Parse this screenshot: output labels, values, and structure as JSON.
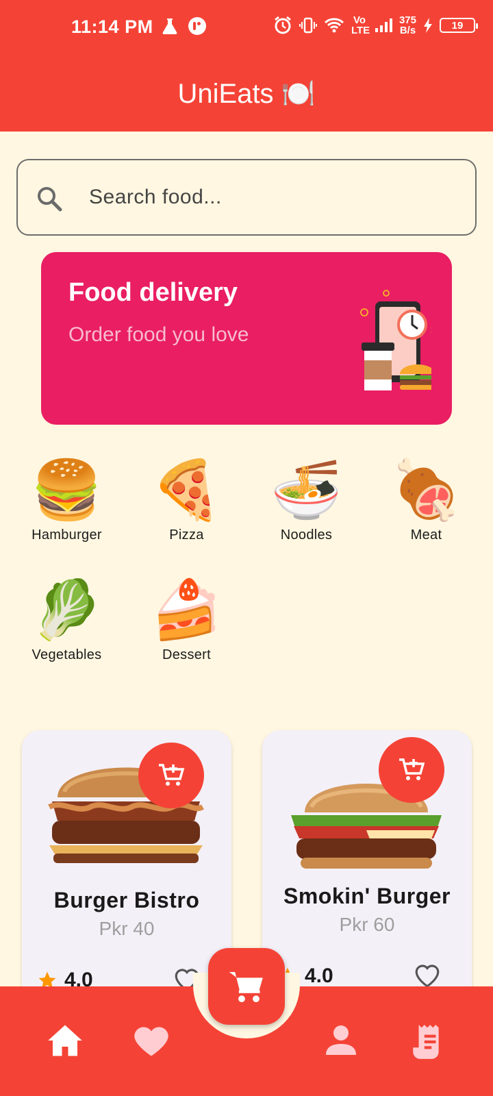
{
  "status_bar": {
    "time": "11:14 PM",
    "net_type": "Vo LTE",
    "speed_value": "375",
    "speed_unit": "B/s",
    "battery": "19"
  },
  "header": {
    "title": "UniEats 🍽️"
  },
  "search": {
    "placeholder": "Search food..."
  },
  "banner": {
    "title": "Food delivery",
    "subtitle": "Order food you love"
  },
  "categories": [
    {
      "label": "Hamburger",
      "emoji": "🍔"
    },
    {
      "label": "Pizza",
      "emoji": "🍕"
    },
    {
      "label": "Noodles",
      "emoji": "🍜"
    },
    {
      "label": "Meat",
      "emoji": "🍖"
    },
    {
      "label": "Vegetables",
      "emoji": "🥬"
    },
    {
      "label": "Dessert",
      "emoji": "🍰"
    }
  ],
  "products": [
    {
      "name": "Burger Bistro",
      "price": "Pkr 40",
      "rating": "4.0"
    },
    {
      "name": "Smokin' Burger",
      "price": "Pkr 60",
      "rating": "4.0"
    }
  ],
  "colors": {
    "primary": "#F44336",
    "banner": "#E91E63",
    "background": "#FFF7E1",
    "card": "#F4F0F8",
    "star": "#FF9800"
  },
  "bottom_nav": [
    "home-icon",
    "heart-icon",
    "cart-icon",
    "person-icon",
    "receipt-icon"
  ]
}
